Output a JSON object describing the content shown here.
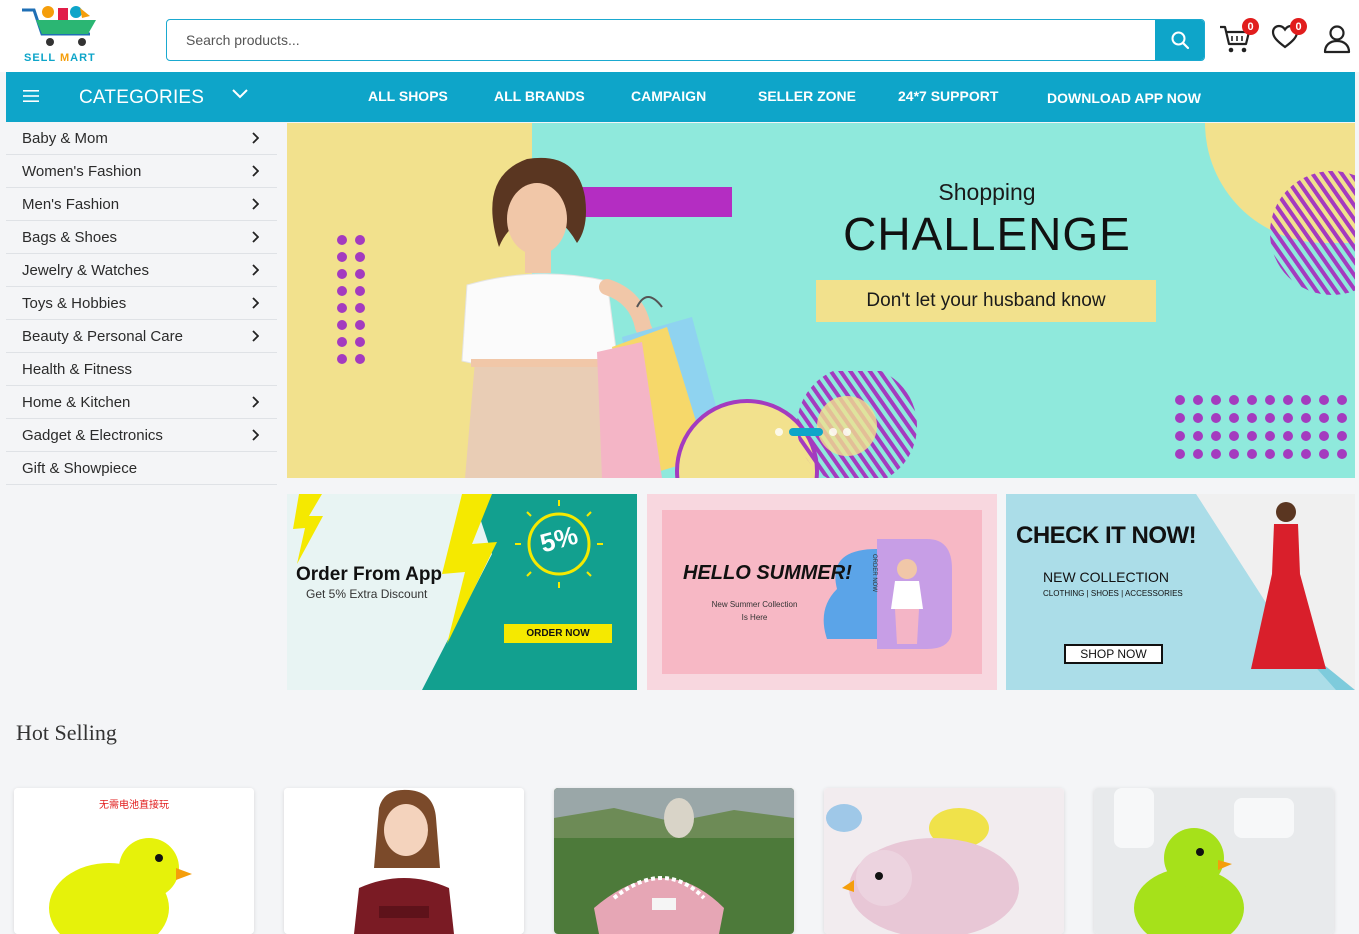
{
  "brand": {
    "logo_text_1": "S",
    "logo_text_mid": "ELL ",
    "logo_text_x": "M",
    "logo_text_end": "ART"
  },
  "search": {
    "placeholder": "Search products..."
  },
  "header": {
    "cart_count": "0",
    "wishlist_count": "0"
  },
  "nav": {
    "categories_label": "CATEGORIES",
    "links": [
      "ALL SHOPS",
      "ALL BRANDS",
      "CAMPAIGN",
      "SELLER ZONE",
      "24*7 SUPPORT",
      "DOWNLOAD APP NOW"
    ]
  },
  "sidebar": {
    "items": [
      {
        "label": "Baby & Mom",
        "has_sub": true
      },
      {
        "label": "Women's Fashion",
        "has_sub": true
      },
      {
        "label": "Men's Fashion",
        "has_sub": true
      },
      {
        "label": "Bags & Shoes",
        "has_sub": true
      },
      {
        "label": "Jewelry & Watches",
        "has_sub": true
      },
      {
        "label": "Toys & Hobbies",
        "has_sub": true
      },
      {
        "label": "Beauty & Personal Care",
        "has_sub": true
      },
      {
        "label": "Health & Fitness",
        "has_sub": false
      },
      {
        "label": "Home & Kitchen",
        "has_sub": true
      },
      {
        "label": "Gadget & Electronics",
        "has_sub": true
      },
      {
        "label": "Gift & Showpiece",
        "has_sub": false
      }
    ]
  },
  "hero": {
    "shopping": "Shopping",
    "challenge": "CHALLENGE",
    "tagline": "Don't let your husband know"
  },
  "promos": {
    "app": {
      "title": "Order From App",
      "subtitle": "Get 5% Extra Discount",
      "badge": "5%",
      "cta": "ORDER NOW"
    },
    "summer": {
      "title": "HELLO SUMMER!",
      "line1": "New Summer Collection",
      "line2": "Is Here",
      "side": "ORDER NOW"
    },
    "check": {
      "title": "CHECK IT NOW!",
      "subtitle": "NEW COLLECTION",
      "tags": "CLOTHING | SHOES | ACCESSORIES",
      "cta": "SHOP NOW"
    }
  },
  "hot_selling": {
    "title": "Hot Selling",
    "cards": [
      {
        "caption": "无需电池直接玩"
      },
      {
        "caption": ""
      },
      {
        "caption": ""
      },
      {
        "caption": ""
      },
      {
        "caption": ""
      }
    ]
  },
  "colors": {
    "accent": "#0ea5c9",
    "badge": "#e11d1d",
    "hero_mint": "#8fe9dc",
    "hero_yellow": "#f2e18d",
    "hero_purple": "#b42dc2"
  }
}
